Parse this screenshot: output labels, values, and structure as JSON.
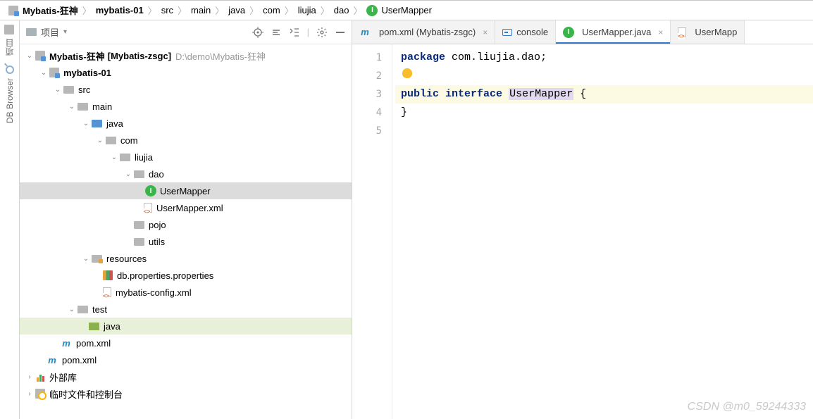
{
  "breadcrumb": {
    "root": "Mybatis-狂神",
    "items": [
      "mybatis-01",
      "src",
      "main",
      "java",
      "com",
      "liujia",
      "dao"
    ],
    "leaf": "UserMapper"
  },
  "leftrail": {
    "project": "项目",
    "db": "DB Browser"
  },
  "projectPanel": {
    "title": "项目"
  },
  "tree": {
    "root_name": "Mybatis-狂神",
    "root_suffix": "[Mybatis-zsgc]",
    "root_path": "D:\\demo\\Mybatis-狂神",
    "module": "mybatis-01",
    "src": "src",
    "main": "main",
    "java": "java",
    "com": "com",
    "liujia": "liujia",
    "dao": "dao",
    "usermapper": "UserMapper",
    "usermapper_xml": "UserMapper.xml",
    "pojo": "pojo",
    "utils": "utils",
    "resources": "resources",
    "dbprops": "db.properties.properties",
    "mybatis_cfg": "mybatis-config.xml",
    "test": "test",
    "test_java": "java",
    "module_pom": "pom.xml",
    "root_pom": "pom.xml",
    "ext_libs": "外部库",
    "scratch": "临时文件和控制台"
  },
  "tabs": {
    "pom": "pom.xml (Mybatis-zsgc)",
    "console": "console",
    "usermapper": "UserMapper.java",
    "usermapper_xml": "UserMapp"
  },
  "code": {
    "l1_kw": "package",
    "l1_pkg": "com.liujia.dao",
    "l3_kw1": "public",
    "l3_kw2": "interface",
    "l3_cls": "UserMapper",
    "l3_brace": "{",
    "l4_brace": "}",
    "gutter": [
      "1",
      "2",
      "3",
      "4",
      "5"
    ]
  },
  "watermark": "CSDN @m0_59244333"
}
